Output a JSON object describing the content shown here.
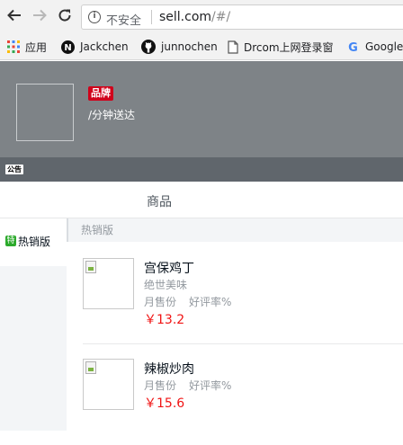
{
  "browser": {
    "security_label": "不安全",
    "info_glyph": "i",
    "url_host": "sell.com",
    "url_path": "/#/",
    "icons": {
      "back": "back-arrow-icon",
      "forward": "forward-arrow-icon",
      "reload": "reload-icon"
    }
  },
  "bookmarks": [
    {
      "label": "应用",
      "icon": "apps-grid-icon"
    },
    {
      "label": "Jackchen",
      "icon": "n-logo-icon"
    },
    {
      "label": "junnochen",
      "icon": "github-icon"
    },
    {
      "label": "Drcom上网登录窗",
      "icon": "page-icon"
    },
    {
      "label": "Google",
      "icon": "google-icon"
    }
  ],
  "header": {
    "brand_badge": "品牌",
    "description": "/分钟送达",
    "bulletin_badge": "公告"
  },
  "tabs": [
    {
      "label": "商品"
    }
  ],
  "menu": [
    {
      "label": "热销版",
      "special_icon": "特",
      "active": true
    }
  ],
  "section": {
    "title": "热销版"
  },
  "foods": [
    {
      "name": "宫保鸡丁",
      "description": "绝世美味",
      "sell_label": "月售份",
      "rating_label": "好评率%",
      "price": "￥13.2"
    },
    {
      "name": "辣椒炒肉",
      "description": "",
      "sell_label": "月售份",
      "rating_label": "好评率%",
      "price": "￥15.6"
    }
  ],
  "colors": {
    "header_bg": "#7e8387",
    "brand_red": "#d0021b",
    "price_red": "#f01414",
    "special_green": "#2caa2c"
  }
}
